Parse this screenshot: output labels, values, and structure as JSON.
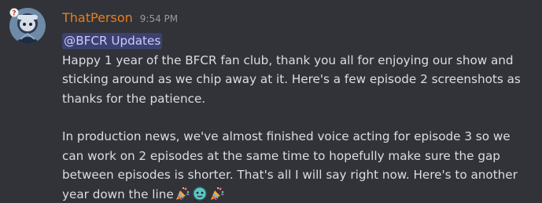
{
  "message": {
    "author": "ThatPerson",
    "author_color": "#e67e22",
    "timestamp": "9:54 PM",
    "mention": "@BFCR Updates",
    "paragraph1": "Happy 1 year of the BFCR fan club, thank you all for enjoying our show and sticking around as we chip away at it. Here's a few episode 2 screenshots as thanks for the patience.",
    "paragraph2": "In production news, we've almost finished voice acting for episode 3 so we can work on 2 episodes at the same time to hopefully make sure the gap between episodes is shorter. That's all I will say right now. Here's to another year down the line",
    "emojis": [
      "party-popper-emoji",
      "character-emoji",
      "party-popper-emoji"
    ]
  },
  "colors": {
    "background": "#313338",
    "text": "#dbdee1",
    "timestamp": "#949ba4",
    "mention_bg": "#3c4270",
    "mention_text": "#c9cdfb"
  }
}
